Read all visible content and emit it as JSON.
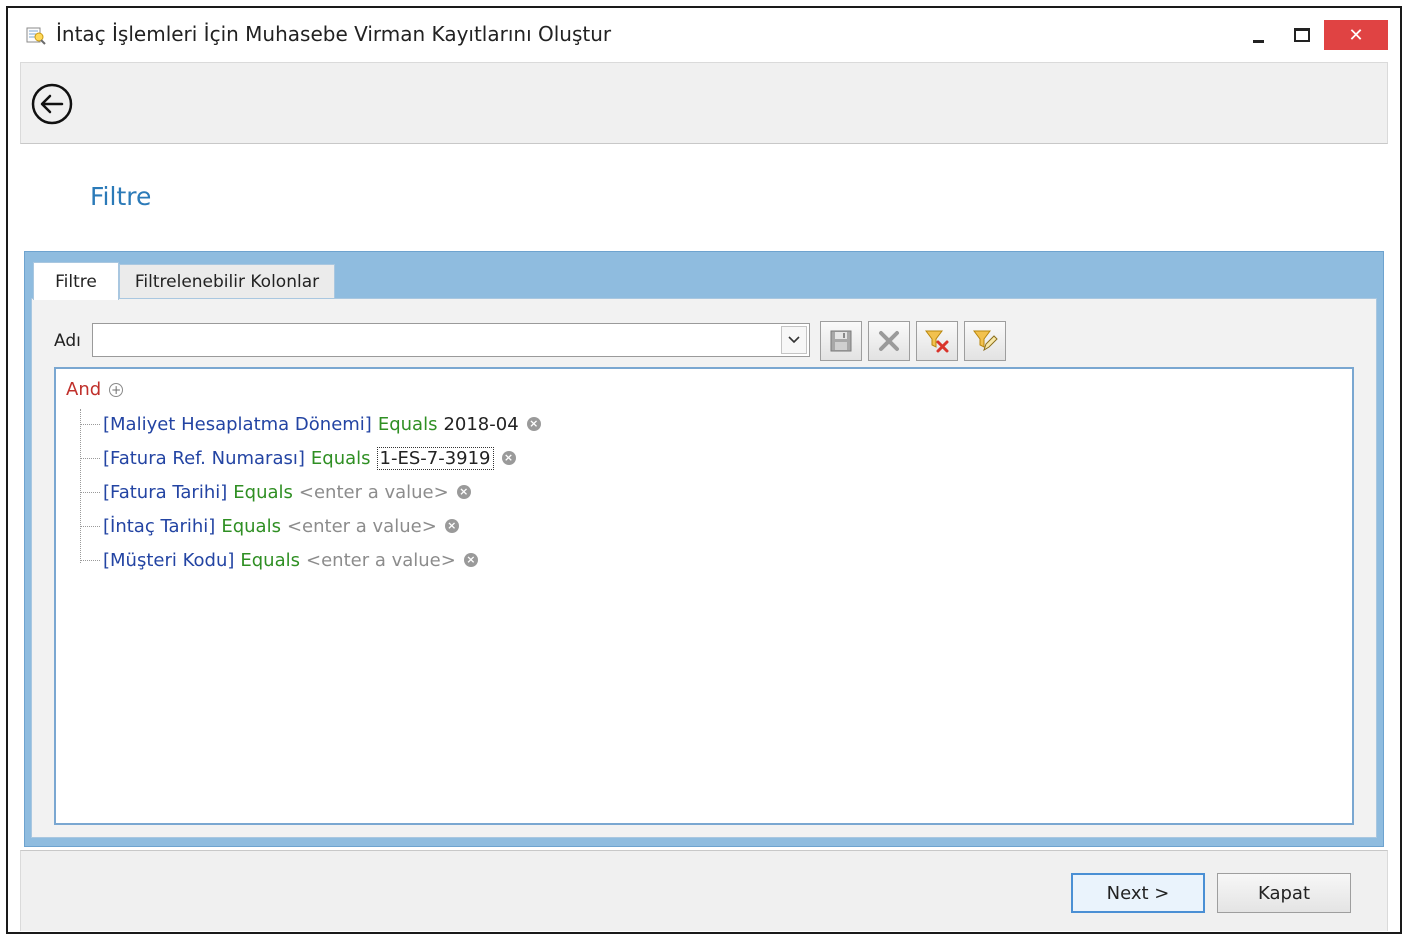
{
  "window": {
    "title": "İntaç İşlemleri İçin Muhasebe Virman Kayıtlarını Oluştur",
    "close_glyph": "✕"
  },
  "page": {
    "title": "Filtre"
  },
  "tabs": [
    {
      "label": "Filtre",
      "active": true
    },
    {
      "label": "Filtrelenebilir Kolonlar",
      "active": false
    }
  ],
  "filter_name": {
    "label": "Adı",
    "value": ""
  },
  "toolbar_icons": [
    "save-icon",
    "delete-icon",
    "clear-filter-icon",
    "edit-filter-icon"
  ],
  "filter_tree": {
    "root": "And",
    "conditions": [
      {
        "field": "[Maliyet Hesaplatma Dönemi]",
        "operator": "Equals",
        "value": "2018-04",
        "is_placeholder": false
      },
      {
        "field": "[Fatura Ref. Numarası]",
        "operator": "Equals",
        "value": "1-ES-7-3919",
        "is_placeholder": false
      },
      {
        "field": "[Fatura Tarihi]",
        "operator": "Equals",
        "value": "<enter a value>",
        "is_placeholder": true
      },
      {
        "field": "[İntaç Tarihi]",
        "operator": "Equals",
        "value": "<enter a value>",
        "is_placeholder": true
      },
      {
        "field": "[Müşteri Kodu]",
        "operator": "Equals",
        "value": "<enter a value>",
        "is_placeholder": true
      }
    ]
  },
  "buttons": {
    "next": "Next >",
    "close": "Kapat"
  },
  "colors": {
    "accent_title": "#2b7ab8",
    "tab_panel": "#8fbcdf",
    "close_button": "#e04343",
    "field": "#2344a3",
    "operator": "#2f8f23",
    "group": "#c0302b"
  }
}
